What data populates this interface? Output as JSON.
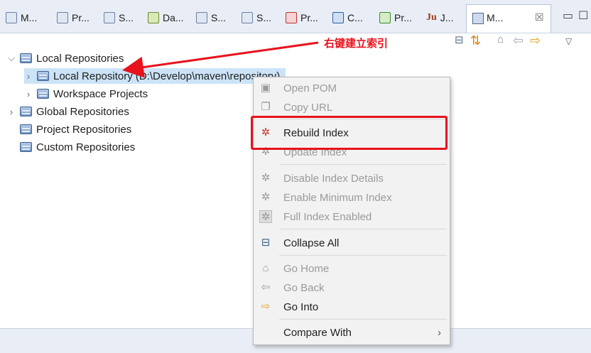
{
  "tabs": [
    {
      "label": "M...",
      "icon": "maven-icon"
    },
    {
      "label": "Pr...",
      "icon": "properties-icon"
    },
    {
      "label": "S...",
      "icon": "servers-icon"
    },
    {
      "label": "Da...",
      "icon": "data-source-icon"
    },
    {
      "label": "S...",
      "icon": "snippets-icon"
    },
    {
      "label": "S...",
      "icon": "search-icon"
    },
    {
      "label": "Pr...",
      "icon": "problems-icon"
    },
    {
      "label": "C...",
      "icon": "console-icon"
    },
    {
      "label": "Pr...",
      "icon": "progress-icon"
    },
    {
      "label": "J...",
      "icon": "junit-icon",
      "prefix": "Ju"
    }
  ],
  "active_tab": {
    "label": "M...",
    "close": "☒"
  },
  "window_controls": {
    "minimize": "▭",
    "maximize": "☐"
  },
  "annotation": "右键建立索引",
  "tree": {
    "local": "Local Repositories",
    "local_repo": "Local Repository (D:\\Develop\\maven\\repository)",
    "workspace": "Workspace Projects",
    "global": "Global Repositories",
    "project": "Project Repositories",
    "custom": "Custom Repositories"
  },
  "menu": {
    "open_pom": "Open POM",
    "copy_url": "Copy URL",
    "rebuild_index": "Rebuild Index",
    "update_index": "Update Index",
    "disable_index_details": "Disable Index Details",
    "enable_minimum_index": "Enable Minimum Index",
    "full_index_enabled": "Full Index Enabled",
    "collapse_all": "Collapse All",
    "go_home": "Go Home",
    "go_back": "Go Back",
    "go_into": "Go Into",
    "compare_with": "Compare With",
    "submenu_arrow": "›"
  },
  "colors": {
    "annotation": "#e8121d",
    "selection": "#cce3f7",
    "accent": "#e8a317"
  }
}
